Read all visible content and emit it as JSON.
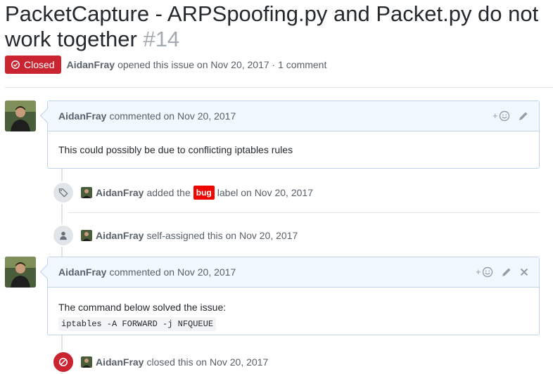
{
  "issue": {
    "title": "PacketCapture - ARPSpoofing.py and Packet.py do not work together",
    "number": "#14",
    "state": "Closed",
    "author": "AidanFray",
    "opened_text": "opened this issue on Nov 20, 2017 · 1 comment"
  },
  "comments": [
    {
      "author": "AidanFray",
      "meta": "commented on Nov 20, 2017",
      "body": "This could possibly be due to conflicting iptables rules"
    },
    {
      "author": "AidanFray",
      "meta": "commented on Nov 20, 2017",
      "body": "The command below solved the issue:",
      "code": "iptables -A FORWARD -j NFQUEUE"
    }
  ],
  "events": {
    "labeled": {
      "actor": "AidanFray",
      "pre": "added the",
      "label": "bug",
      "post": "label on Nov 20, 2017"
    },
    "assigned": {
      "actor": "AidanFray",
      "text": "self-assigned this on Nov 20, 2017"
    },
    "closed": {
      "actor": "AidanFray",
      "text": "closed this on Nov 20, 2017"
    }
  },
  "colors": {
    "closed": "#cb2431",
    "bug_label": "#ee0701",
    "comment_border": "#c0d3eb",
    "comment_header": "#f1f8ff"
  },
  "icons": [
    "issue-closed-icon",
    "smiley-icon",
    "pencil-icon",
    "close-icon",
    "tag-icon",
    "person-icon",
    "circle-slash-icon"
  ]
}
